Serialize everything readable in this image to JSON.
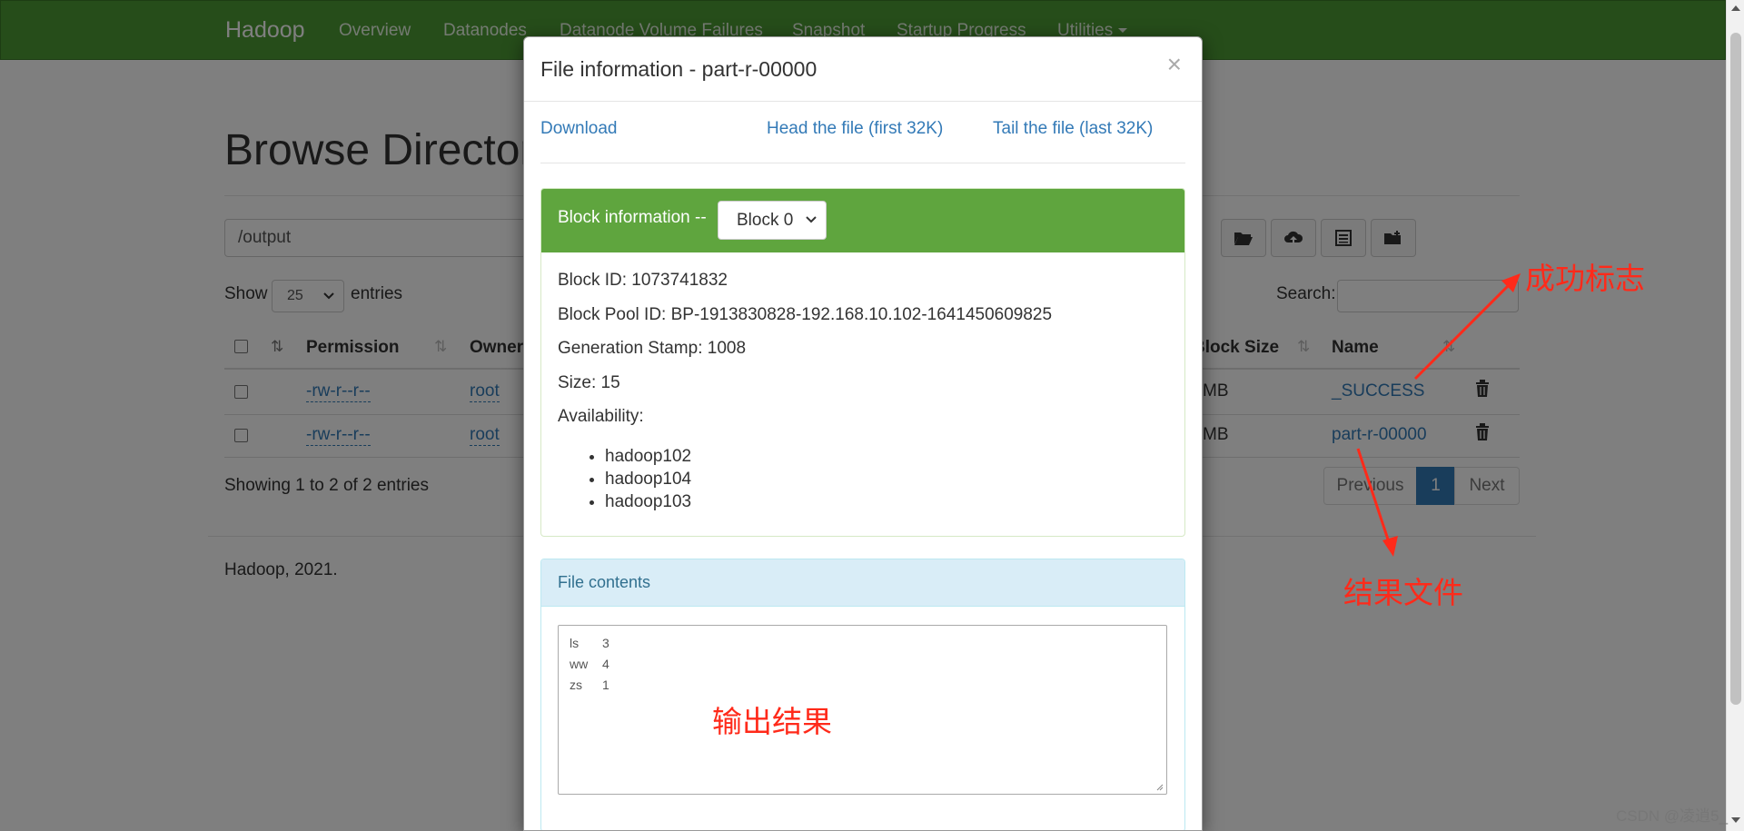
{
  "navbar": {
    "brand": "Hadoop",
    "links": [
      "Overview",
      "Datanodes",
      "Datanode Volume Failures",
      "Snapshot",
      "Startup Progress",
      "Utilities"
    ]
  },
  "page": {
    "title": "Browse Directory",
    "path_value": "/output",
    "show_label": "Show",
    "entries_value": "25",
    "entries_label": "entries",
    "search_label": "Search:",
    "toolbar_icons": [
      "folder-open-icon",
      "cloud-upload-icon",
      "list-alt-icon",
      "folder-plus-icon"
    ]
  },
  "table": {
    "columns": [
      "Permission",
      "Owner",
      "Block Size",
      "Name"
    ],
    "rows": [
      {
        "permission": "-rw-r--r--",
        "owner": "root",
        "block_size": "MB",
        "name": "_SUCCESS"
      },
      {
        "permission": "-rw-r--r--",
        "owner": "root",
        "block_size": "MB",
        "name": "part-r-00000"
      }
    ],
    "info": "Showing 1 to 2 of 2 entries",
    "pagination": {
      "previous": "Previous",
      "current": "1",
      "next": "Next"
    }
  },
  "footer": {
    "text": "Hadoop, 2021."
  },
  "modal": {
    "title": "File information - part-r-00000",
    "close": "×",
    "links": {
      "download": "Download",
      "head": "Head the file (first 32K)",
      "tail": "Tail the file (last 32K)"
    },
    "block": {
      "heading": "Block information --",
      "selected": "Block 0",
      "id_line": "Block ID: 1073741832",
      "pool_line": "Block Pool ID: BP-1913830828-192.168.10.102-1641450609825",
      "stamp_line": "Generation Stamp: 1008",
      "size_line": "Size: 15",
      "availability_label": "Availability:",
      "hosts": [
        "hadoop102",
        "hadoop104",
        "hadoop103"
      ]
    },
    "contents": {
      "heading": "File contents",
      "rows": [
        {
          "word": "ls",
          "count": "3"
        },
        {
          "word": "ww",
          "count": "4"
        },
        {
          "word": "zs",
          "count": "1"
        }
      ]
    }
  },
  "annotations": {
    "success_flag": "成功标志",
    "result_file": "结果文件",
    "output_result": "输出结果",
    "color": "#ff2a1a"
  },
  "watermark": "CSDN @凌逍5_"
}
